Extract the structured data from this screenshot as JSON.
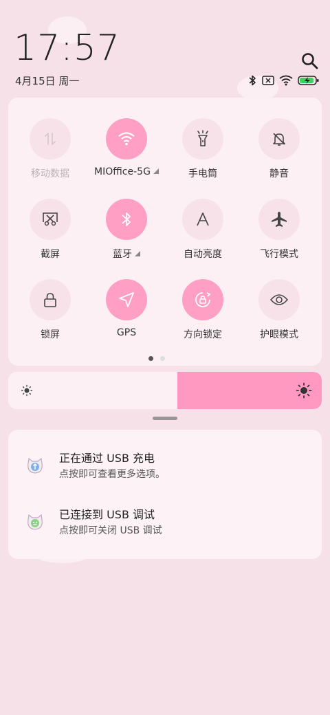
{
  "status_bar": {
    "time": "17:57",
    "date": "4月15日 周一",
    "icons": [
      "bluetooth-icon",
      "no-sim-icon",
      "wifi-icon",
      "battery-charging-icon"
    ]
  },
  "quick_settings": {
    "tiles": [
      {
        "label": "移动数据",
        "icon": "mobile-data-icon",
        "active": false,
        "enabled": false
      },
      {
        "label": "MIOffice-5G",
        "icon": "wifi-icon",
        "active": true,
        "expandable": true
      },
      {
        "label": "手电筒",
        "icon": "flashlight-icon",
        "active": false
      },
      {
        "label": "静音",
        "icon": "mute-bell-icon",
        "active": false
      },
      {
        "label": "截屏",
        "icon": "screenshot-icon",
        "active": false
      },
      {
        "label": "蓝牙",
        "icon": "bluetooth-icon",
        "active": true,
        "expandable": true
      },
      {
        "label": "自动亮度",
        "icon": "auto-brightness-icon",
        "active": false
      },
      {
        "label": "飞行模式",
        "icon": "airplane-icon",
        "active": false
      },
      {
        "label": "锁屏",
        "icon": "lock-icon",
        "active": false
      },
      {
        "label": "GPS",
        "icon": "gps-icon",
        "active": true
      },
      {
        "label": "方向锁定",
        "icon": "rotation-lock-icon",
        "active": true
      },
      {
        "label": "护眼模式",
        "icon": "eye-icon",
        "active": false
      }
    ],
    "page_indicator": {
      "pages": 2,
      "current": 1
    }
  },
  "brightness": {
    "level": 0.46,
    "accent": "#ff99c2"
  },
  "notifications": [
    {
      "title": "正在通过 USB 充电",
      "subtitle": "点按即可查看更多选项。",
      "icon": "usb-charging-cat-icon"
    },
    {
      "title": "已连接到 USB 调试",
      "subtitle": "点按即可关闭 USB 调试",
      "icon": "usb-debug-cat-icon"
    }
  ],
  "colors": {
    "active_tile": "#ff9fc4",
    "background": "#f6e1e8"
  }
}
